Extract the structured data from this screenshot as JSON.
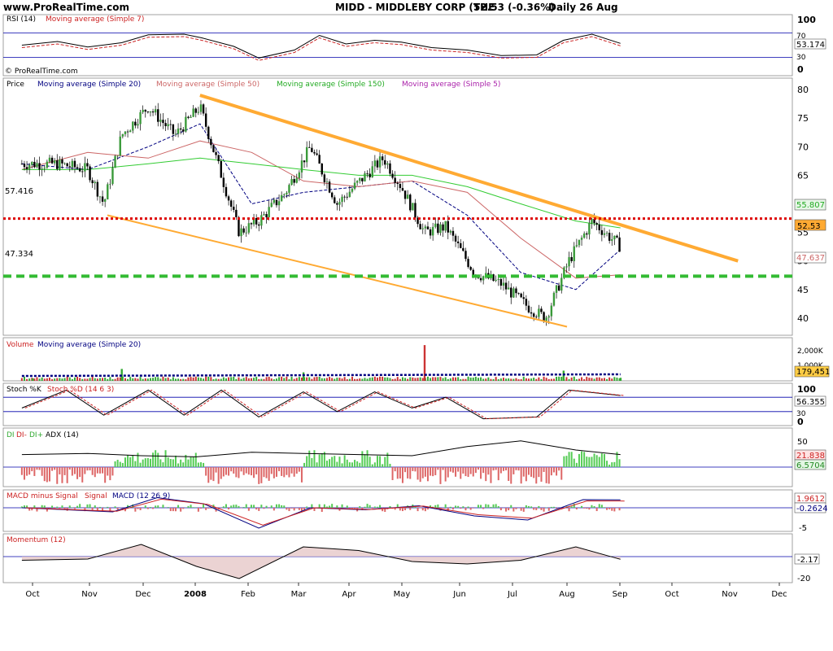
{
  "header": {
    "site": "www.ProRealTime.com",
    "symbol_title": "MIDD - MIDDLEBY CORP (THE",
    "price_change": "52.53 (-0.36%)",
    "period": "Daily 26 Aug"
  },
  "colors": {
    "grid": "#0000aa",
    "panel_border": "#8a8a8a",
    "price_up": "#3a9a3a",
    "sma20": "#000080",
    "sma50": "#cc6666",
    "sma150": "#33cc33",
    "sma5": "#aa22aa",
    "channel": "#ffaa33",
    "resistance": "#dd0000",
    "support": "#33bb33"
  },
  "chart_data": [
    {
      "type": "line",
      "panel": "rsi",
      "legend": [
        "RSI (14)",
        "Moving average (Simple 7)"
      ],
      "ylim": [
        0,
        100
      ],
      "ticks": [
        "100",
        "0"
      ],
      "levels": [
        70,
        30
      ],
      "level_labels": [
        "70",
        "30"
      ],
      "last_value_label": "53.174",
      "series": [
        {
          "name": "RSI (14)",
          "x": [
            "2007-09-25",
            "2007-10-15",
            "2007-11-01",
            "2007-11-20",
            "2007-12-05",
            "2007-12-25",
            "2008-01-04",
            "2008-01-22",
            "2008-02-05",
            "2008-02-25",
            "2008-03-10",
            "2008-03-25",
            "2008-04-10",
            "2008-04-25",
            "2008-05-12",
            "2008-06-01",
            "2008-06-20",
            "2008-07-10",
            "2008-07-25",
            "2008-08-10",
            "2008-08-26"
          ],
          "values": [
            50,
            56,
            47,
            54,
            67,
            68,
            62,
            48,
            29,
            42,
            66,
            52,
            58,
            55,
            46,
            42,
            33,
            34,
            58,
            68,
            53
          ]
        }
      ]
    },
    {
      "type": "line",
      "panel": "price",
      "legend": [
        "Price",
        "Moving average (Simple 20)",
        "Moving average (Simple 50)",
        "Moving average (Simple 150)",
        "Moving average (Simple 5)"
      ],
      "ylim": [
        37,
        82
      ],
      "yticks": [
        40,
        45,
        50,
        55,
        60,
        65,
        70,
        75,
        80
      ],
      "xticks": [
        "Oct",
        "Nov",
        "Dec",
        "2008",
        "Feb",
        "Mar",
        "Apr",
        "May",
        "Jun",
        "Jul",
        "Aug",
        "Sep",
        "Oct",
        "Nov",
        "Dec"
      ],
      "resistance_label": "57.416",
      "support_label": "47.334",
      "value_labels": [
        "55.807",
        "52.53",
        "47.637"
      ],
      "series": [
        {
          "name": "Price",
          "x": [
            "2007-09-25",
            "2007-10-15",
            "2007-11-01",
            "2007-11-10",
            "2007-11-20",
            "2007-12-05",
            "2007-12-20",
            "2008-01-03",
            "2008-01-12",
            "2008-01-25",
            "2008-02-05",
            "2008-02-20",
            "2008-03-05",
            "2008-03-20",
            "2008-04-05",
            "2008-04-15",
            "2008-04-25",
            "2008-05-08",
            "2008-05-20",
            "2008-06-05",
            "2008-06-20",
            "2008-07-05",
            "2008-07-15",
            "2008-07-28",
            "2008-08-10",
            "2008-08-26"
          ],
          "values": [
            67,
            67,
            66,
            60,
            72,
            77,
            72,
            77,
            68,
            55,
            57,
            62,
            70,
            60,
            65,
            68,
            63,
            55,
            56,
            48,
            46,
            42,
            40,
            50,
            57,
            52.53
          ]
        },
        {
          "name": "Moving average (Simple 20)",
          "x": [
            "2007-09-25",
            "2007-11-01",
            "2007-12-05",
            "2008-01-03",
            "2008-02-01",
            "2008-03-01",
            "2008-04-01",
            "2008-05-01",
            "2008-06-01",
            "2008-07-01",
            "2008-08-01",
            "2008-08-26"
          ],
          "values": [
            67,
            66,
            70,
            74,
            60,
            62,
            63,
            64,
            58,
            48,
            45,
            52
          ]
        },
        {
          "name": "Moving average (Simple 50)",
          "x": [
            "2007-09-25",
            "2007-11-01",
            "2007-12-05",
            "2008-01-03",
            "2008-02-01",
            "2008-03-01",
            "2008-04-01",
            "2008-05-01",
            "2008-06-01",
            "2008-07-01",
            "2008-08-01",
            "2008-08-26"
          ],
          "values": [
            66,
            69,
            68,
            71,
            69,
            64,
            63,
            64,
            62,
            54,
            47,
            47.6
          ]
        },
        {
          "name": "Moving average (Simple 150)",
          "x": [
            "2007-09-25",
            "2007-11-01",
            "2007-12-05",
            "2008-01-03",
            "2008-02-01",
            "2008-03-01",
            "2008-04-01",
            "2008-05-01",
            "2008-06-01",
            "2008-07-01",
            "2008-08-01",
            "2008-08-26"
          ],
          "values": [
            66,
            66,
            67,
            68,
            67,
            66,
            65,
            65,
            63,
            60,
            57,
            55.8
          ]
        }
      ]
    },
    {
      "type": "bar",
      "panel": "volume",
      "legend": [
        "Volume",
        "Moving average (Simple 20)"
      ],
      "yticks": [
        "2,000K",
        "1,000K"
      ],
      "last_value_label": "179,451",
      "x": [
        "2007-10-01",
        "2007-11-20",
        "2008-03-01",
        "2008-05-08",
        "2008-07-25",
        "2008-08-26"
      ],
      "values": [
        150000,
        700000,
        500000,
        2100000,
        600000,
        179451
      ]
    },
    {
      "type": "line",
      "panel": "stochastic",
      "legend": [
        "Stoch %K",
        "Stoch %D (14 6 3)"
      ],
      "ticks": [
        "100",
        "0"
      ],
      "level_labels": [
        "30"
      ],
      "last_value_label": "56.355",
      "x": [
        "2007-09-25",
        "2007-10-20",
        "2007-11-10",
        "2007-12-05",
        "2007-12-25",
        "2008-01-15",
        "2008-02-05",
        "2008-03-01",
        "2008-03-20",
        "2008-04-10",
        "2008-05-01",
        "2008-05-20",
        "2008-06-10",
        "2008-07-10",
        "2008-07-28",
        "2008-08-26"
      ],
      "values": [
        40,
        90,
        20,
        90,
        20,
        90,
        15,
        85,
        30,
        85,
        40,
        70,
        10,
        15,
        90,
        75
      ]
    },
    {
      "type": "area",
      "panel": "adx",
      "legend": [
        "DI",
        "DI-",
        "DI+",
        "ADX (14)"
      ],
      "ticks": [
        "50"
      ],
      "value_labels": [
        "21.838",
        "6.5704"
      ],
      "x": [
        "2007-09-25",
        "2007-11-01",
        "2007-12-01",
        "2008-01-01",
        "2008-02-01",
        "2008-03-01",
        "2008-04-01",
        "2008-05-01",
        "2008-06-01",
        "2008-07-01",
        "2008-08-01",
        "2008-08-26"
      ],
      "values": [
        22,
        24,
        20,
        18,
        26,
        24,
        22,
        20,
        36,
        46,
        30,
        22
      ]
    },
    {
      "type": "line",
      "panel": "macd",
      "legend": [
        "MACD minus Signal",
        "Signal",
        "MACD (12 26 9)"
      ],
      "ticks": [
        "-5"
      ],
      "value_labels": [
        "1.9612",
        "-0.2624"
      ],
      "x": [
        "2007-09-25",
        "2007-11-15",
        "2007-12-10",
        "2008-01-05",
        "2008-02-05",
        "2008-03-05",
        "2008-04-05",
        "2008-05-05",
        "2008-06-05",
        "2008-07-05",
        "2008-08-05",
        "2008-08-26"
      ],
      "values": [
        0,
        -1,
        2.5,
        1,
        -5,
        0,
        -0.5,
        0.5,
        -2,
        -3,
        2,
        1.96
      ]
    },
    {
      "type": "area",
      "panel": "momentum",
      "legend": [
        "Momentum (12)"
      ],
      "ticks": [
        "-20"
      ],
      "last_value_label": "-2.17",
      "x": [
        "2007-09-25",
        "2007-11-01",
        "2007-12-01",
        "2008-01-01",
        "2008-01-25",
        "2008-03-01",
        "2008-04-01",
        "2008-05-01",
        "2008-06-01",
        "2008-07-01",
        "2008-08-01",
        "2008-08-26"
      ],
      "values": [
        -3,
        -2,
        10,
        -8,
        -18,
        8,
        5,
        -4,
        -6,
        -3,
        8,
        -2.17
      ]
    }
  ]
}
